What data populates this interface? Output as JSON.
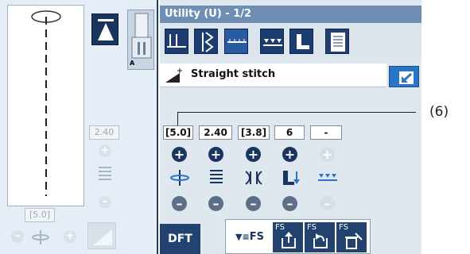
{
  "header": {
    "title": "Utility (U) - 1/2"
  },
  "stitch": {
    "name": "Straight stitch"
  },
  "values": {
    "stitch_length": "[5.0]",
    "width": "2.40",
    "tension": "[3.8]",
    "pressure": "6",
    "other": "-"
  },
  "left_panel": {
    "width_value": "2.40",
    "length_value": "[5.0]",
    "foot_letter": "A"
  },
  "buttons": {
    "dft": "DFT",
    "fs": "FS",
    "fs_save": "FS",
    "fs_recall": "FS",
    "fs_delete": "FS"
  },
  "callout": {
    "label": "(6)"
  },
  "colors": {
    "accent": "#22436f",
    "header": "#6e8fb3",
    "blue_button": "#2a74c9"
  }
}
